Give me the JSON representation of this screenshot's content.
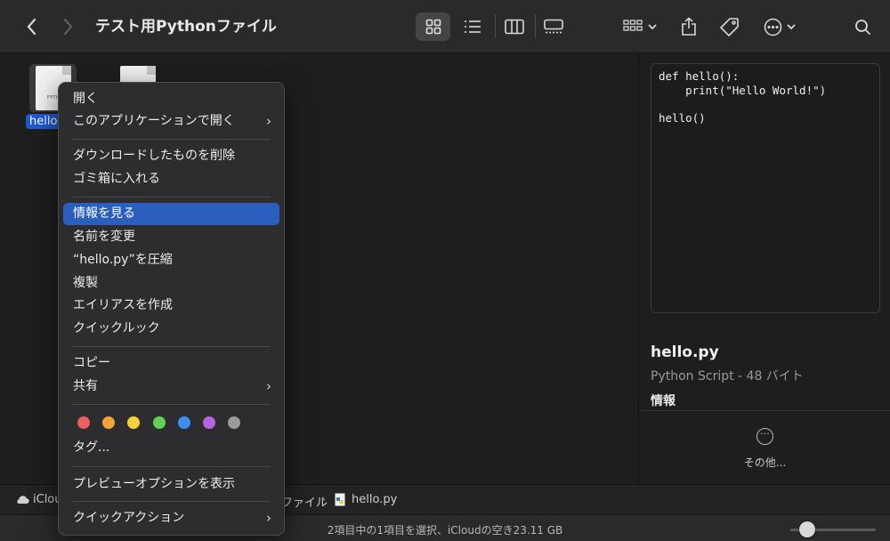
{
  "toolbar": {
    "back_icon": "chevron-left-icon",
    "forward_icon": "chevron-right-icon",
    "title": "テスト用Pythonファイル",
    "views": [
      "icon-view",
      "list-view",
      "column-view",
      "gallery-view"
    ],
    "group_icon": "group-icon",
    "share_icon": "share-icon",
    "tag_icon": "tag-icon",
    "action_icon": "ellipsis-circle-icon",
    "search_icon": "search-icon"
  },
  "files": [
    {
      "label": "hello",
      "icon_text": "PYTH",
      "selected": true
    },
    {
      "label": "",
      "icon_text": "",
      "selected": false
    }
  ],
  "preview": {
    "code": "def hello():\n    print(\"Hello World!\")\n\nhello()",
    "filename": "hello.py",
    "kind": "Python Script - 48 バイト",
    "info_heading": "情報",
    "more_label": "その他..."
  },
  "pathbar": {
    "root": "iClou",
    "folder": "ファイル",
    "separator": "›",
    "file": "hello.py"
  },
  "status": {
    "text": "2項目中の1項目を選択、iCloudの空き23.11 GB"
  },
  "menu": {
    "open": "開く",
    "open_with": "このアプリケーションで開く",
    "remove_download": "ダウンロードしたものを削除",
    "trash": "ゴミ箱に入れる",
    "get_info": "情報を見る",
    "rename": "名前を変更",
    "compress": "“hello.py”を圧縮",
    "duplicate": "複製",
    "make_alias": "エイリアスを作成",
    "quick_look": "クイックルック",
    "copy": "コピー",
    "share": "共有",
    "tags": "タグ...",
    "preview_options": "プレビューオプションを表示",
    "quick_actions": "クイックアクション",
    "submenu_arrow": "›",
    "tag_colors": [
      "#ec5f5d",
      "#f3a33b",
      "#f4d23c",
      "#64cf58",
      "#3e8ef5",
      "#b665e2",
      "#9b9b9b"
    ]
  },
  "colors": {
    "highlight": "#2a5fc0",
    "selection": "#1e5ad6"
  }
}
